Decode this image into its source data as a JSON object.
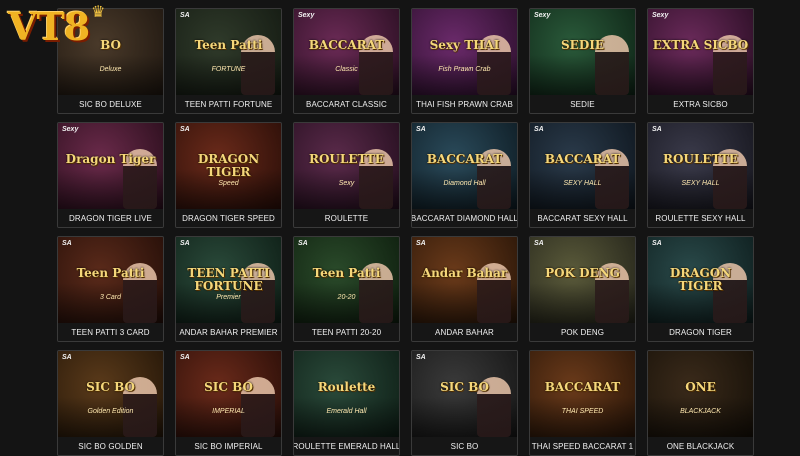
{
  "brand": {
    "name": "VT8",
    "crown": "♛"
  },
  "games": [
    {
      "label": "SIC BO DELUXE",
      "provider": "",
      "logo": "BO",
      "sub": "Deluxe",
      "bg": "#4a3a2a",
      "bg2": "#1f1710",
      "person": false
    },
    {
      "label": "TEEN PATTI FORTUNE",
      "provider": "SA",
      "logo": "Teen Patti",
      "sub": "FORTUNE",
      "bg": "#2f3a2a",
      "bg2": "#141a12",
      "person": true
    },
    {
      "label": "BACCARAT CLASSIC",
      "provider": "Sexy",
      "logo": "BACCARAT",
      "sub": "Classic",
      "bg": "#6a2a55",
      "bg2": "#2a0f22",
      "person": true
    },
    {
      "label": "THAI FISH PRAWN CRAB",
      "provider": "",
      "logo": "Sexy THAI",
      "sub": "Fish Prawn Crab",
      "bg": "#6a2a6a",
      "bg2": "#2c0f2c",
      "person": true
    },
    {
      "label": "SEDIE",
      "provider": "Sexy",
      "logo": "SEDIE",
      "sub": "",
      "bg": "#2a5a3a",
      "bg2": "#0e2416",
      "person": true
    },
    {
      "label": "EXTRA SICBO",
      "provider": "Sexy",
      "logo": "EXTRA SICBO",
      "sub": "",
      "bg": "#6a2a5a",
      "bg2": "#2a0e24",
      "person": true
    },
    {
      "label": "DRAGON TIGER LIVE",
      "provider": "Sexy",
      "logo": "Dragon Tiger",
      "sub": "",
      "bg": "#6a2a4a",
      "bg2": "#2a0e1c",
      "person": true
    },
    {
      "label": "DRAGON TIGER SPEED",
      "provider": "SA",
      "logo": "DRAGON TIGER",
      "sub": "Speed",
      "bg": "#6a2a1a",
      "bg2": "#2a0e08",
      "person": false
    },
    {
      "label": "ROULETTE",
      "provider": "",
      "logo": "ROULETTE",
      "sub": "Sexy",
      "bg": "#5a2a4a",
      "bg2": "#240e1e",
      "person": true
    },
    {
      "label": "BACCARAT DIAMOND HALL",
      "provider": "SA",
      "logo": "BACCARAT",
      "sub": "Diamond Hall",
      "bg": "#2a4a5a",
      "bg2": "#0e1c24",
      "person": true
    },
    {
      "label": "BACCARAT SEXY HALL",
      "provider": "SA",
      "logo": "BACCARAT",
      "sub": "SEXY HALL",
      "bg": "#2a3a4a",
      "bg2": "#0e161e",
      "person": true
    },
    {
      "label": "ROULETTE SEXY HALL",
      "provider": "SA",
      "logo": "ROULETTE",
      "sub": "SEXY HALL",
      "bg": "#3a3a4a",
      "bg2": "#16161e",
      "person": true
    },
    {
      "label": "TEEN PATTI 3 CARD",
      "provider": "SA",
      "logo": "Teen Patti",
      "sub": "3 Card",
      "bg": "#5a2a1a",
      "bg2": "#240e08",
      "person": true
    },
    {
      "label": "ANDAR BAHAR PREMIER",
      "provider": "SA",
      "logo": "TEEN PATTI FORTUNE",
      "sub": "Premier",
      "bg": "#2a4a3a",
      "bg2": "#0e1e16",
      "person": true
    },
    {
      "label": "TEEN PATTI 20-20",
      "provider": "SA",
      "logo": "Teen Patti",
      "sub": "20-20",
      "bg": "#2a4a2a",
      "bg2": "#0e1e0e",
      "person": true
    },
    {
      "label": "ANDAR BAHAR",
      "provider": "SA",
      "logo": "Andar Bahar",
      "sub": "",
      "bg": "#6a3a1a",
      "bg2": "#2a1608",
      "person": true
    },
    {
      "label": "POK DENG",
      "provider": "SA",
      "logo": "POK DENG",
      "sub": "",
      "bg": "#5a5a3a",
      "bg2": "#24241a",
      "person": true
    },
    {
      "label": "DRAGON TIGER",
      "provider": "SA",
      "logo": "DRAGON TIGER",
      "sub": "",
      "bg": "#2a4a4a",
      "bg2": "#0e1e1e",
      "person": true
    },
    {
      "label": "SIC BO GOLDEN",
      "provider": "SA",
      "logo": "SIC BO",
      "sub": "Golden Edition",
      "bg": "#5a3a1a",
      "bg2": "#241608",
      "person": true
    },
    {
      "label": "SIC BO IMPERIAL",
      "provider": "SA",
      "logo": "SIC BO",
      "sub": "IMPERIAL",
      "bg": "#6a2a1a",
      "bg2": "#2a0e08",
      "person": true
    },
    {
      "label": "ROULETTE EMERALD HALL",
      "provider": "",
      "logo": "Roulette",
      "sub": "Emerald Hall",
      "bg": "#2a4a3a",
      "bg2": "#0e1e16",
      "person": false
    },
    {
      "label": "SIC BO",
      "provider": "SA",
      "logo": "SIC BO",
      "sub": "",
      "bg": "#3a3a3a",
      "bg2": "#161616",
      "person": true
    },
    {
      "label": "THAI SPEED BACCARAT 1",
      "provider": "",
      "logo": "BACCARAT",
      "sub": "THAI SPEED",
      "bg": "#6a3a1a",
      "bg2": "#2a1608",
      "person": false
    },
    {
      "label": "ONE BLACKJACK",
      "provider": "",
      "logo": "ONE",
      "sub": "BLACKJACK",
      "bg": "#3a2a1a",
      "bg2": "#161008",
      "person": false
    }
  ]
}
